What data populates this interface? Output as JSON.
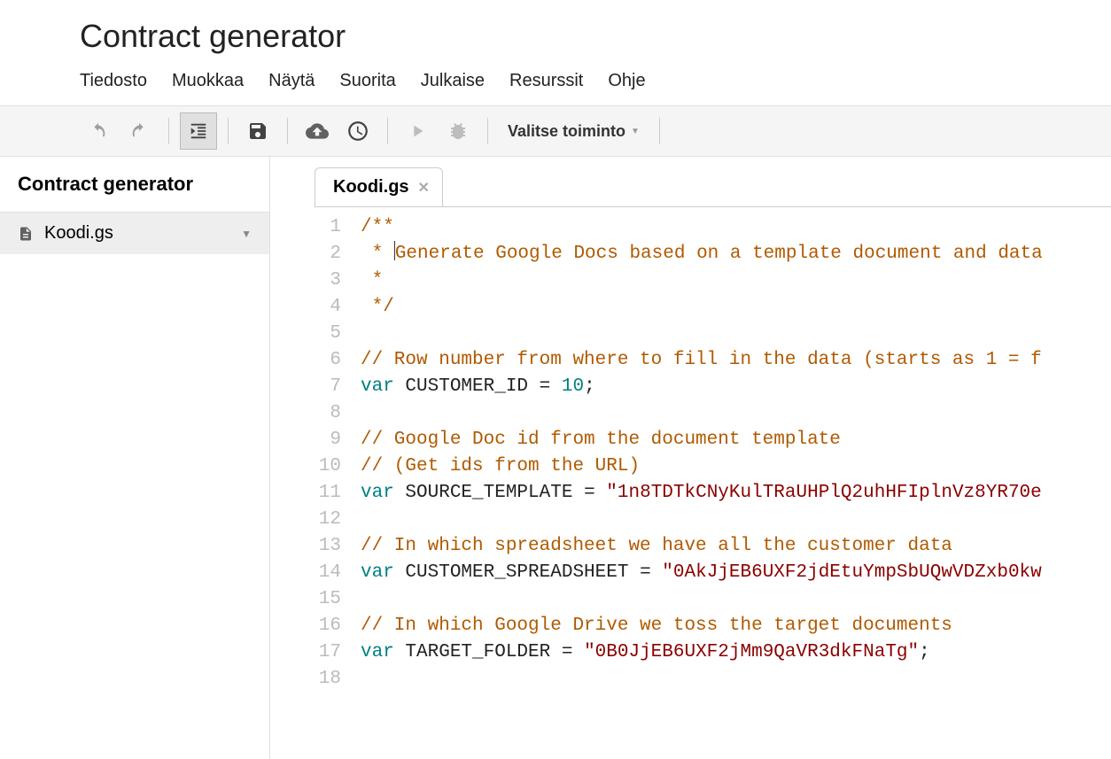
{
  "header": {
    "title": "Contract generator"
  },
  "menu": {
    "items": [
      "Tiedosto",
      "Muokkaa",
      "Näytä",
      "Suorita",
      "Julkaise",
      "Resurssit",
      "Ohje"
    ]
  },
  "toolbar": {
    "function_select": "Valitse toiminto"
  },
  "sidebar": {
    "project_name": "Contract generator",
    "files": [
      "Koodi.gs"
    ]
  },
  "editor": {
    "tabs": [
      {
        "label": "Koodi.gs"
      }
    ],
    "code_lines": [
      {
        "n": 1,
        "tokens": [
          {
            "t": "/**",
            "c": "comment"
          }
        ]
      },
      {
        "n": 2,
        "tokens": [
          {
            "t": " * ",
            "c": "comment"
          },
          {
            "t": "CURSOR"
          },
          {
            "t": "Generate Google Docs based on a template document and data",
            "c": "comment"
          }
        ]
      },
      {
        "n": 3,
        "tokens": [
          {
            "t": " *",
            "c": "comment"
          }
        ]
      },
      {
        "n": 4,
        "tokens": [
          {
            "t": " */",
            "c": "comment"
          }
        ]
      },
      {
        "n": 5,
        "tokens": []
      },
      {
        "n": 6,
        "tokens": [
          {
            "t": "// Row number from where to fill in the data (starts as 1 = f",
            "c": "comment"
          }
        ]
      },
      {
        "n": 7,
        "tokens": [
          {
            "t": "var",
            "c": "keyword"
          },
          {
            "t": " CUSTOMER_ID ",
            "c": "ident"
          },
          {
            "t": "=",
            "c": "punc"
          },
          {
            "t": " ",
            "c": "ident"
          },
          {
            "t": "10",
            "c": "num"
          },
          {
            "t": ";",
            "c": "punc"
          }
        ]
      },
      {
        "n": 8,
        "tokens": []
      },
      {
        "n": 9,
        "tokens": [
          {
            "t": "// Google Doc id from the document template",
            "c": "comment"
          }
        ]
      },
      {
        "n": 10,
        "tokens": [
          {
            "t": "// (Get ids from the URL)",
            "c": "comment"
          }
        ]
      },
      {
        "n": 11,
        "tokens": [
          {
            "t": "var",
            "c": "keyword"
          },
          {
            "t": " SOURCE_TEMPLATE ",
            "c": "ident"
          },
          {
            "t": "=",
            "c": "punc"
          },
          {
            "t": " ",
            "c": "ident"
          },
          {
            "t": "\"1n8TDTkCNyKulTRaUHPlQ2uhHFIplnVz8YR70e",
            "c": "string"
          }
        ]
      },
      {
        "n": 12,
        "tokens": []
      },
      {
        "n": 13,
        "tokens": [
          {
            "t": "// In which spreadsheet we have all the customer data",
            "c": "comment"
          }
        ]
      },
      {
        "n": 14,
        "tokens": [
          {
            "t": "var",
            "c": "keyword"
          },
          {
            "t": " CUSTOMER_SPREADSHEET ",
            "c": "ident"
          },
          {
            "t": "=",
            "c": "punc"
          },
          {
            "t": " ",
            "c": "ident"
          },
          {
            "t": "\"0AkJjEB6UXF2jdEtuYmpSbUQwVDZxb0kw",
            "c": "string"
          }
        ]
      },
      {
        "n": 15,
        "tokens": []
      },
      {
        "n": 16,
        "tokens": [
          {
            "t": "// In which Google Drive we toss the target documents",
            "c": "comment"
          }
        ]
      },
      {
        "n": 17,
        "tokens": [
          {
            "t": "var",
            "c": "keyword"
          },
          {
            "t": " TARGET_FOLDER ",
            "c": "ident"
          },
          {
            "t": "=",
            "c": "punc"
          },
          {
            "t": " ",
            "c": "ident"
          },
          {
            "t": "\"0B0JjEB6UXF2jMm9QaVR3dkFNaTg\"",
            "c": "string"
          },
          {
            "t": ";",
            "c": "punc"
          }
        ]
      },
      {
        "n": 18,
        "tokens": []
      }
    ]
  }
}
